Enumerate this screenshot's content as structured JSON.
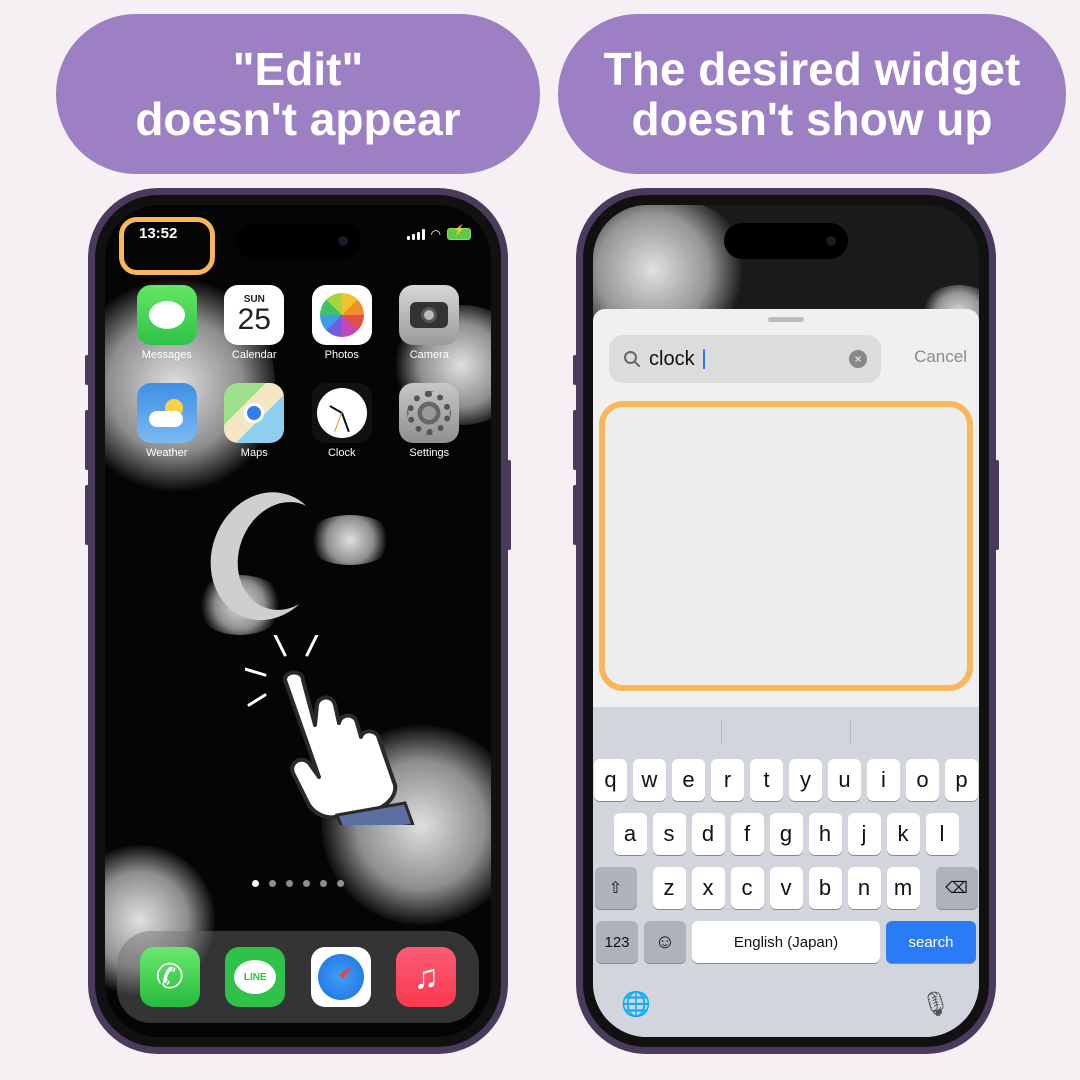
{
  "banners": {
    "left": {
      "line1": "\"Edit\"",
      "line2": "doesn't appear"
    },
    "right": {
      "line1": "The desired widget",
      "line2": "doesn't show up"
    }
  },
  "left_phone": {
    "status": {
      "time": "13:52"
    },
    "apps": [
      {
        "label": "Messages",
        "icon": "messages-icon"
      },
      {
        "label": "Calendar",
        "icon": "calendar-icon",
        "dow": "SUN",
        "day": "25"
      },
      {
        "label": "Photos",
        "icon": "photos-icon"
      },
      {
        "label": "Camera",
        "icon": "camera-icon"
      },
      {
        "label": "Weather",
        "icon": "weather-icon"
      },
      {
        "label": "Maps",
        "icon": "maps-icon"
      },
      {
        "label": "Clock",
        "icon": "clock-icon"
      },
      {
        "label": "Settings",
        "icon": "settings-icon"
      }
    ],
    "page_dots": {
      "count": 6,
      "active": 0
    },
    "dock": [
      {
        "name": "Phone",
        "icon": "phone-icon",
        "glyph": "✆"
      },
      {
        "name": "LINE",
        "icon": "line-icon",
        "glyph": "LINE"
      },
      {
        "name": "Safari",
        "icon": "safari-icon"
      },
      {
        "name": "Music",
        "icon": "music-icon",
        "glyph": "♫"
      }
    ]
  },
  "right_phone": {
    "search": {
      "value": "clock",
      "clear_glyph": "×"
    },
    "cancel_label": "Cancel",
    "keyboard": {
      "row1": [
        "q",
        "w",
        "e",
        "r",
        "t",
        "y",
        "u",
        "i",
        "o",
        "p"
      ],
      "row2": [
        "a",
        "s",
        "d",
        "f",
        "g",
        "h",
        "j",
        "k",
        "l"
      ],
      "row3": [
        "z",
        "x",
        "c",
        "v",
        "b",
        "n",
        "m"
      ],
      "shift_glyph": "⇧",
      "delete_glyph": "⌫",
      "numbers_label": "123",
      "emoji_glyph": "☺",
      "space_label": "English (Japan)",
      "search_label": "search",
      "globe_glyph": "🌐",
      "mic_glyph": "🎙"
    }
  },
  "colors": {
    "banner": "#9d7fc4",
    "highlight": "#f8b75a",
    "keyboard_accent": "#2a7cf6"
  }
}
